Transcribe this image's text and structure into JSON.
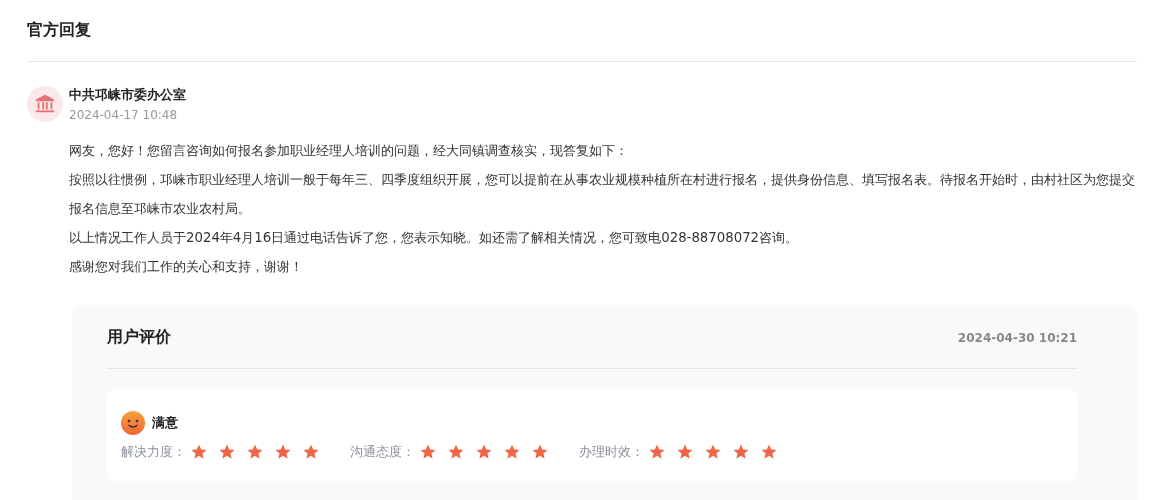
{
  "section_title": "官方回复",
  "reply": {
    "author": "中共邛崃市委办公室",
    "time": "2024-04-17 10:48",
    "paragraphs": [
      "网友，您好！您留言咨询如何报名参加职业经理人培训的问题，经大同镇调查核实，现答复如下：",
      "按照以往惯例，邛崃市职业经理人培训一般于每年三、四季度组织开展，您可以提前在从事农业规模种植所在村进行报名，提供身份信息、填写报名表。待报名开始时，由村社区为您提交报名信息至邛崃市农业农村局。",
      "以上情况工作人员于2024年4月16日通过电话告诉了您，您表示知晓。如还需了解相关情况，您可致电028-88708072咨询。",
      "感谢您对我们工作的关心和支持，谢谢！"
    ]
  },
  "evaluation": {
    "title": "用户评价",
    "time": "2024-04-30 10:21",
    "verdict": "满意",
    "ratings": [
      {
        "label": "解决力度：",
        "stars": 5
      },
      {
        "label": "沟通态度：",
        "stars": 5
      },
      {
        "label": "办理时效：",
        "stars": 5
      }
    ]
  }
}
